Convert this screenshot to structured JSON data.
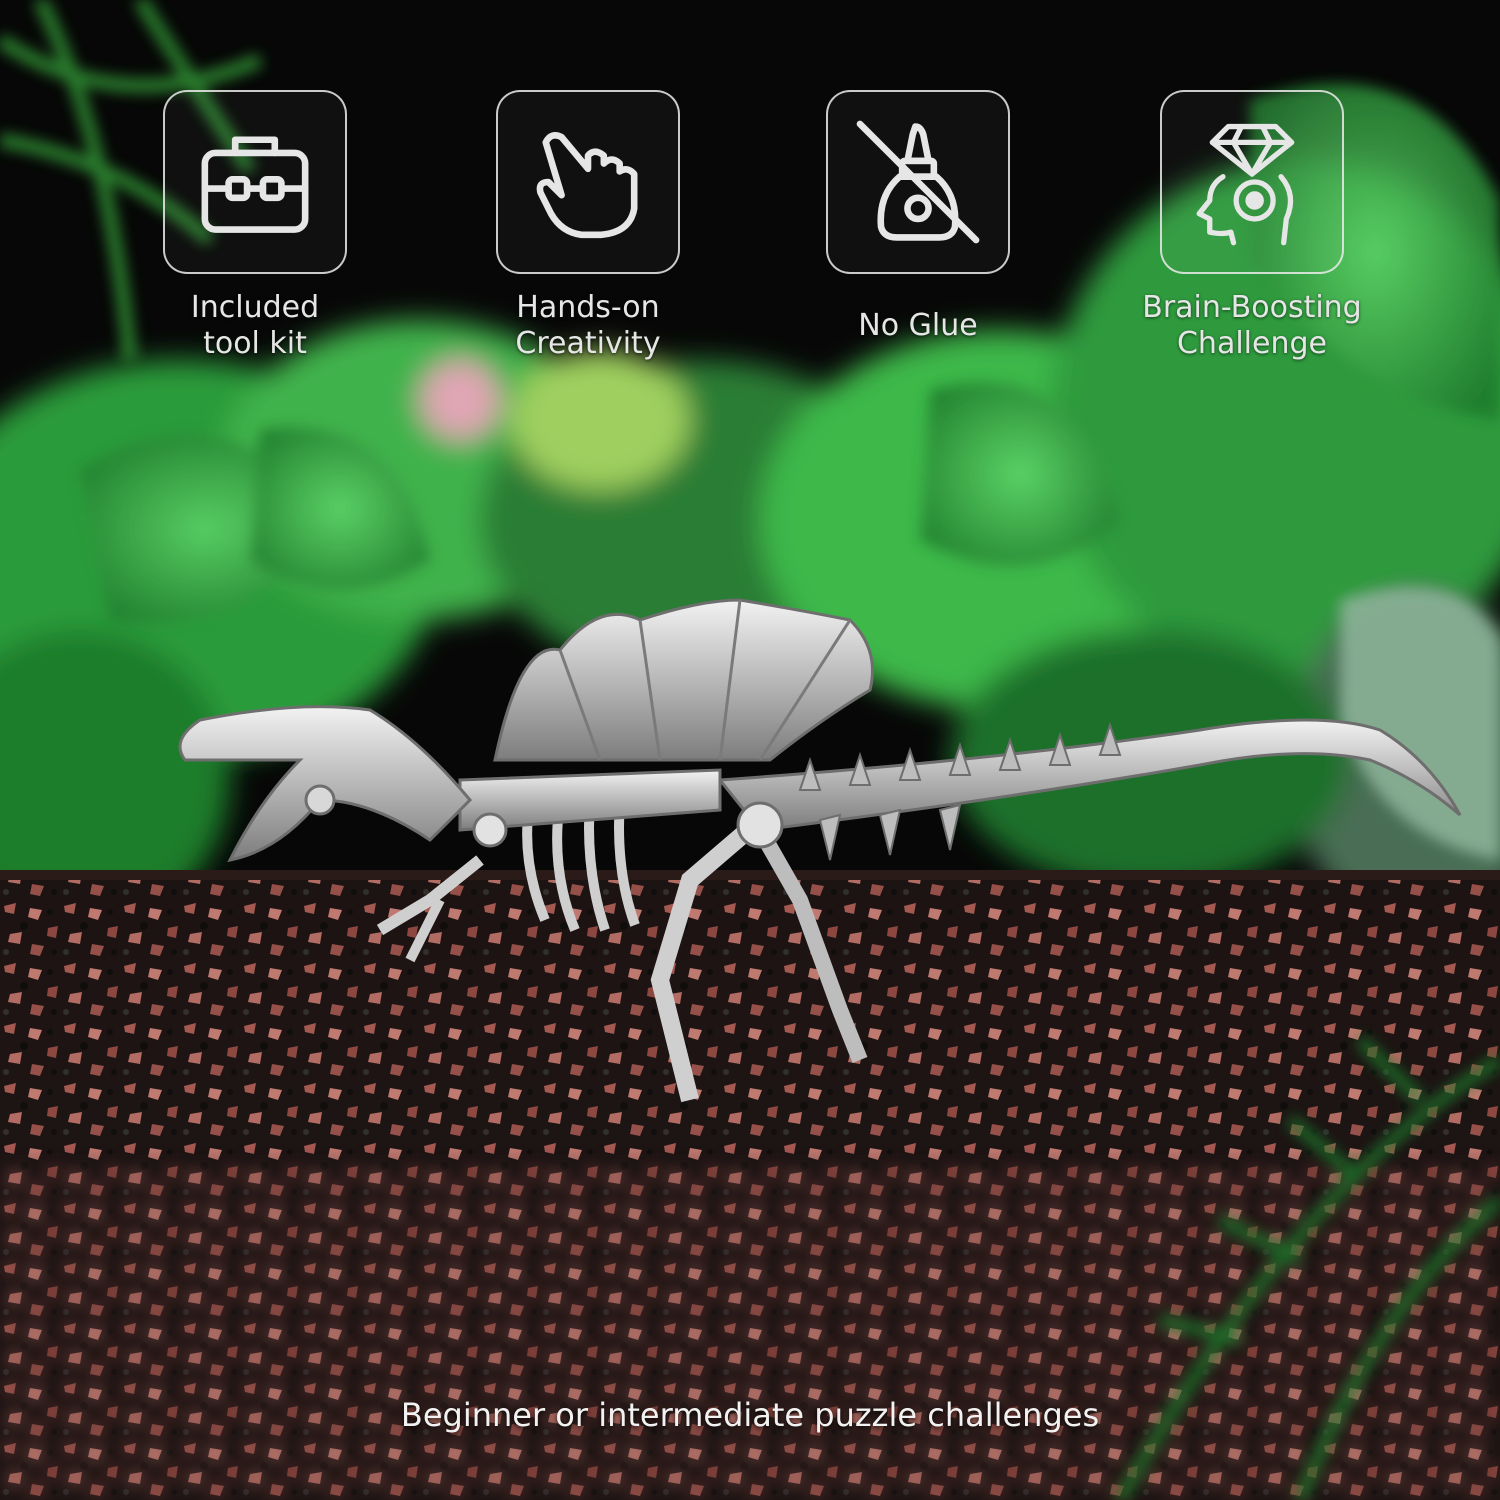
{
  "features": [
    {
      "icon": "toolbox-icon",
      "label": "Included\ntool kit"
    },
    {
      "icon": "hand-pointer-icon",
      "label": "Hands-on\nCreativity"
    },
    {
      "icon": "no-glue-icon",
      "label": "No Glue"
    },
    {
      "icon": "brain-diamond-icon",
      "label": "Brain-Boosting\nChallenge"
    }
  ],
  "caption": "Beginner or intermediate puzzle challenges",
  "colors": {
    "icon_stroke": "#e6e6e6",
    "label_text": "#e6e6e6",
    "foliage": "#2f9a3a",
    "gravel_red": "#b8635a",
    "gravel_black": "#141414",
    "model_silver": "#c9c9c9"
  }
}
